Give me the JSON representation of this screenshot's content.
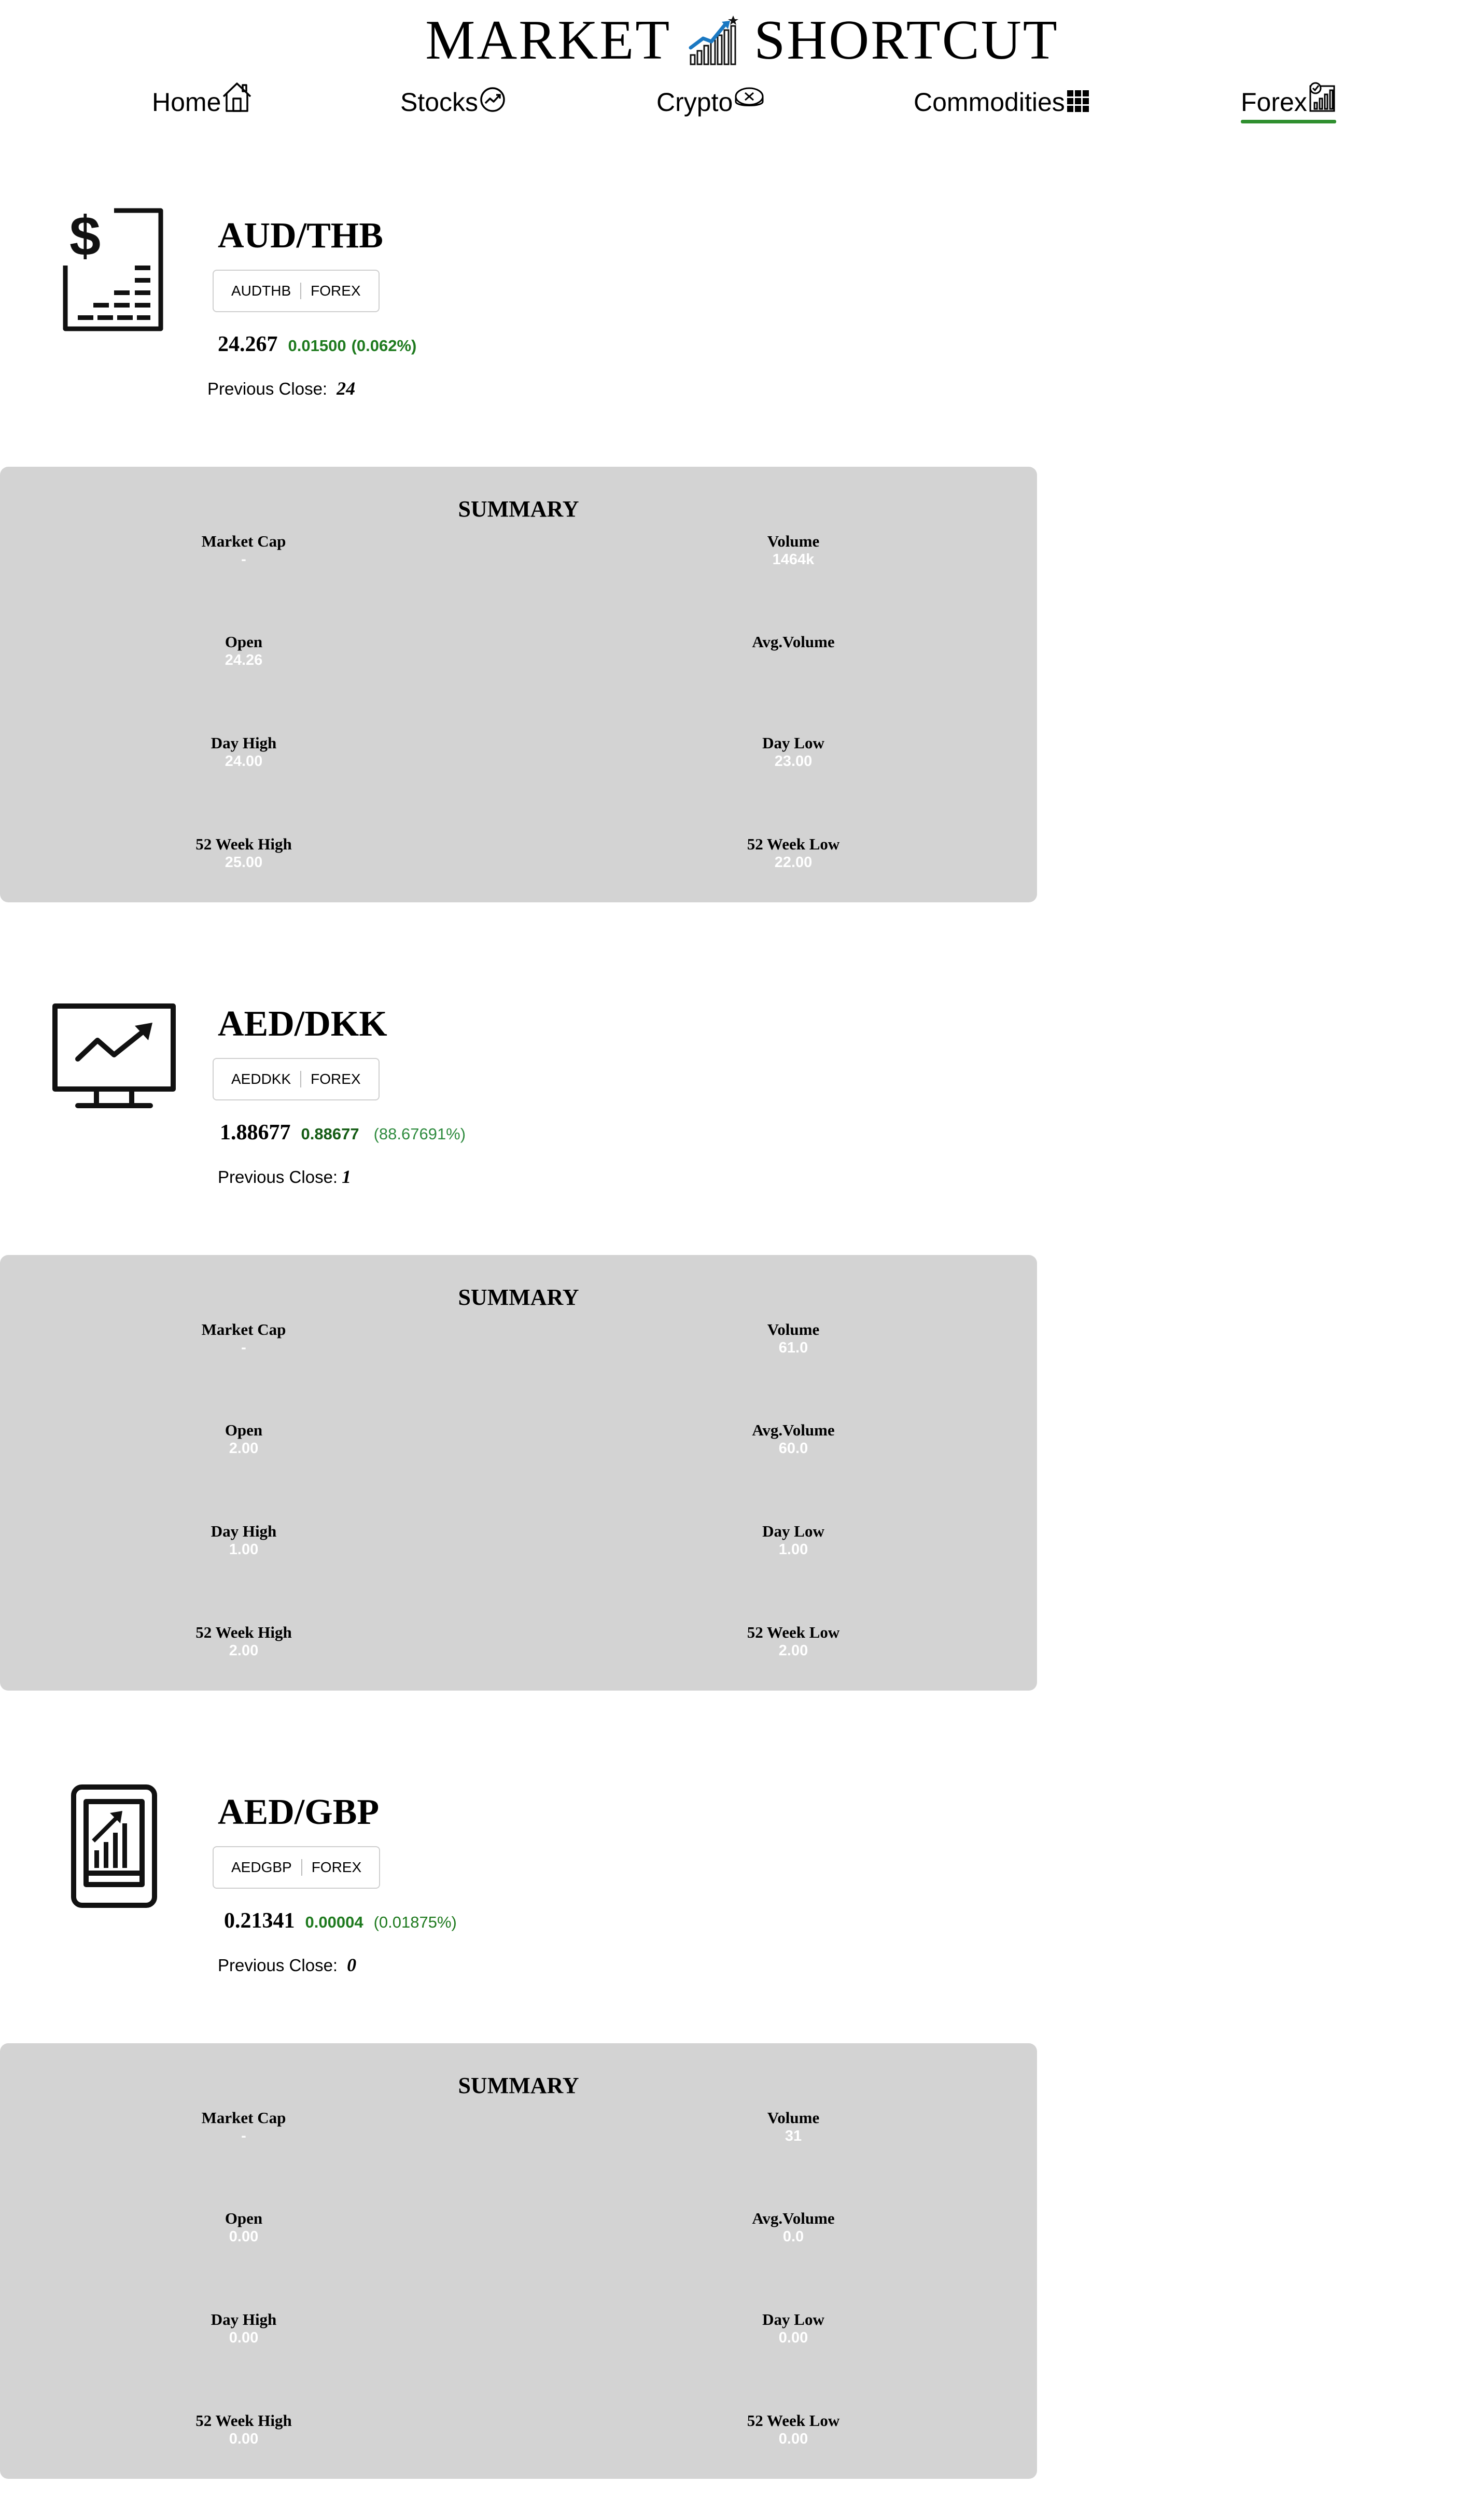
{
  "header": {
    "brand_left": "MARKET",
    "brand_right": "SHORTCUT",
    "brand_icon": "rising-bar-chart-icon",
    "accent_color": "#2f8f2f"
  },
  "nav": [
    {
      "label": "Home",
      "icon": "house-icon",
      "active": false
    },
    {
      "label": "Stocks",
      "icon": "trend-circle-icon",
      "active": false
    },
    {
      "label": "Crypto",
      "icon": "coin-icon",
      "active": false
    },
    {
      "label": "Commodities",
      "icon": "grid-icon",
      "active": false
    },
    {
      "label": "Forex",
      "icon": "chart-report-icon",
      "active": true
    }
  ],
  "pairs": [
    {
      "title": "AUD/THB",
      "icon": "dollar-document-icon",
      "symbol": "AUDTHB",
      "market": "FOREX",
      "price": "24.267",
      "change": "0.01500",
      "change_pct": "(0.062%)",
      "prev_close_label": "Previous Close:",
      "prev_close": "24",
      "summary": {
        "title": "SUMMARY",
        "stats": {
          "market_cap": {
            "label": "Market Cap",
            "value": "-"
          },
          "volume": {
            "label": "Volume",
            "value": "1464k"
          },
          "open": {
            "label": "Open",
            "value": "24.26"
          },
          "avg_volume": {
            "label": "Avg.Volume",
            "value": ""
          },
          "day_high": {
            "label": "Day High",
            "value": "24.00"
          },
          "day_low": {
            "label": "Day Low",
            "value": "23.00"
          },
          "week52_high": {
            "label": "52 Week High",
            "value": "25.00"
          },
          "week52_low": {
            "label": "52 Week Low",
            "value": "22.00"
          }
        }
      }
    },
    {
      "title": "AED/DKK",
      "icon": "monitor-trend-icon",
      "symbol": "AEDDKK",
      "market": "FOREX",
      "price": "1.88677",
      "change": "0.88677",
      "change_pct": "(88.67691%)",
      "prev_close_label": "Previous Close:",
      "prev_close": "1",
      "summary": {
        "title": "SUMMARY",
        "stats": {
          "market_cap": {
            "label": "Market Cap",
            "value": "-"
          },
          "volume": {
            "label": "Volume",
            "value": "61.0"
          },
          "open": {
            "label": "Open",
            "value": "2.00"
          },
          "avg_volume": {
            "label": "Avg.Volume",
            "value": "60.0"
          },
          "day_high": {
            "label": "Day High",
            "value": "1.00"
          },
          "day_low": {
            "label": "Day Low",
            "value": "1.00"
          },
          "week52_high": {
            "label": "52 Week High",
            "value": "2.00"
          },
          "week52_low": {
            "label": "52 Week Low",
            "value": "2.00"
          }
        }
      }
    },
    {
      "title": "AED/GBP",
      "icon": "tablet-chart-icon",
      "symbol": "AEDGBP",
      "market": "FOREX",
      "price": "0.21341",
      "change": "0.00004",
      "change_pct": "(0.01875%)",
      "prev_close_label": "Previous Close:",
      "prev_close": "0",
      "summary": {
        "title": "SUMMARY",
        "stats": {
          "market_cap": {
            "label": "Market Cap",
            "value": "-"
          },
          "volume": {
            "label": "Volume",
            "value": "31"
          },
          "open": {
            "label": "Open",
            "value": "0.00"
          },
          "avg_volume": {
            "label": "Avg.Volume",
            "value": "0.0"
          },
          "day_high": {
            "label": "Day High",
            "value": "0.00"
          },
          "day_low": {
            "label": "Day Low",
            "value": "0.00"
          },
          "week52_high": {
            "label": "52 Week High",
            "value": "0.00"
          },
          "week52_low": {
            "label": "52 Week Low",
            "value": "0.00"
          }
        }
      }
    }
  ]
}
